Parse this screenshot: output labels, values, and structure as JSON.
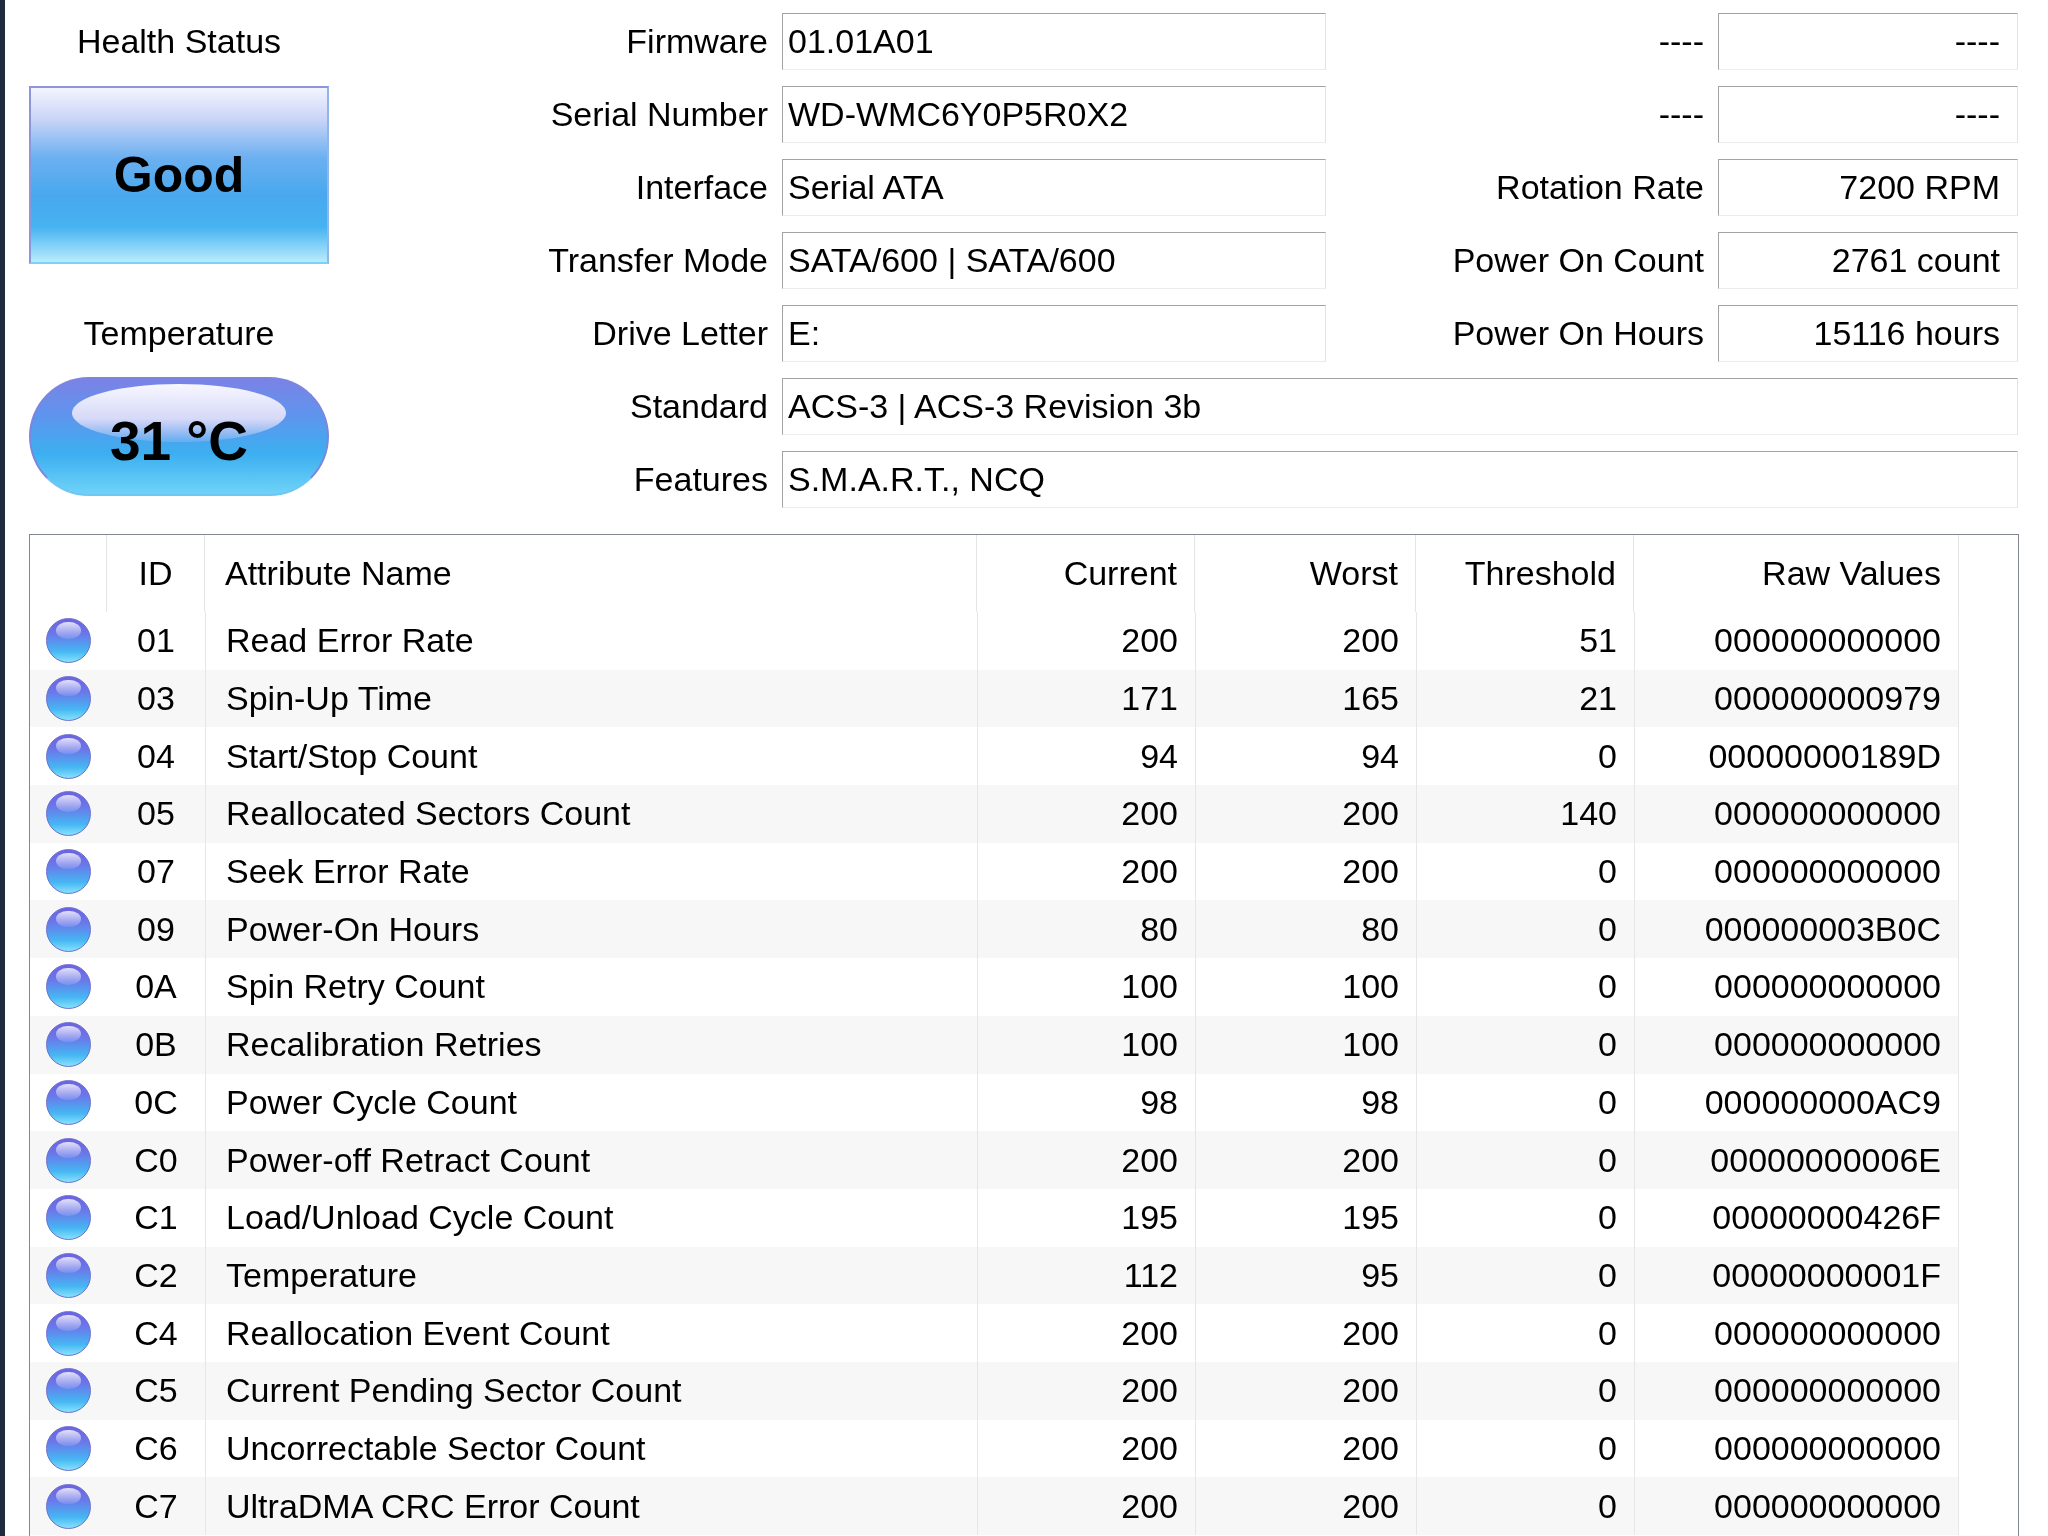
{
  "health": {
    "label": "Health Status",
    "value": "Good"
  },
  "temperature": {
    "label": "Temperature",
    "value": "31 °C"
  },
  "info_left": [
    {
      "label": "Firmware",
      "value": "01.01A01"
    },
    {
      "label": "Serial Number",
      "value": "WD-WMC6Y0P5R0X2"
    },
    {
      "label": "Interface",
      "value": "Serial ATA"
    },
    {
      "label": "Transfer Mode",
      "value": "SATA/600 | SATA/600"
    },
    {
      "label": "Drive Letter",
      "value": "E:"
    }
  ],
  "info_right": [
    {
      "label": "----",
      "value": "----"
    },
    {
      "label": "----",
      "value": "----"
    },
    {
      "label": "Rotation Rate",
      "value": "7200 RPM"
    },
    {
      "label": "Power On Count",
      "value": "2761 count"
    },
    {
      "label": "Power On Hours",
      "value": "15116 hours"
    }
  ],
  "info_wide": [
    {
      "label": "Standard",
      "value": "ACS-3 | ACS-3 Revision 3b"
    },
    {
      "label": "Features",
      "value": "S.M.A.R.T., NCQ"
    }
  ],
  "table": {
    "columns": [
      "ID",
      "Attribute Name",
      "Current",
      "Worst",
      "Threshold",
      "Raw Values"
    ],
    "rows": [
      {
        "selected": false,
        "cells": [
          "01",
          "Read Error Rate",
          "200",
          "200",
          "51",
          "000000000000"
        ]
      },
      {
        "selected": false,
        "cells": [
          "03",
          "Spin-Up Time",
          "171",
          "165",
          "21",
          "000000000979"
        ]
      },
      {
        "selected": false,
        "cells": [
          "04",
          "Start/Stop Count",
          "94",
          "94",
          "0",
          "00000000189D"
        ]
      },
      {
        "selected": false,
        "cells": [
          "05",
          "Reallocated Sectors Count",
          "200",
          "200",
          "140",
          "000000000000"
        ]
      },
      {
        "selected": false,
        "cells": [
          "07",
          "Seek Error Rate",
          "200",
          "200",
          "0",
          "000000000000"
        ]
      },
      {
        "selected": false,
        "cells": [
          "09",
          "Power-On Hours",
          "80",
          "80",
          "0",
          "000000003B0C"
        ]
      },
      {
        "selected": false,
        "cells": [
          "0A",
          "Spin Retry Count",
          "100",
          "100",
          "0",
          "000000000000"
        ]
      },
      {
        "selected": false,
        "cells": [
          "0B",
          "Recalibration Retries",
          "100",
          "100",
          "0",
          "000000000000"
        ]
      },
      {
        "selected": false,
        "cells": [
          "0C",
          "Power Cycle Count",
          "98",
          "98",
          "0",
          "000000000AC9"
        ]
      },
      {
        "selected": false,
        "cells": [
          "C0",
          "Power-off Retract Count",
          "200",
          "200",
          "0",
          "00000000006E"
        ]
      },
      {
        "selected": false,
        "cells": [
          "C1",
          "Load/Unload Cycle Count",
          "195",
          "195",
          "0",
          "00000000426F"
        ]
      },
      {
        "selected": false,
        "cells": [
          "C2",
          "Temperature",
          "112",
          "95",
          "0",
          "00000000001F"
        ]
      },
      {
        "selected": false,
        "cells": [
          "C4",
          "Reallocation Event Count",
          "200",
          "200",
          "0",
          "000000000000"
        ]
      },
      {
        "selected": false,
        "cells": [
          "C5",
          "Current Pending Sector Count",
          "200",
          "200",
          "0",
          "000000000000"
        ]
      },
      {
        "selected": false,
        "cells": [
          "C6",
          "Uncorrectable Sector Count",
          "200",
          "200",
          "0",
          "000000000000"
        ]
      },
      {
        "selected": false,
        "cells": [
          "C7",
          "UltraDMA CRC Error Count",
          "200",
          "200",
          "0",
          "000000000000"
        ]
      }
    ]
  }
}
